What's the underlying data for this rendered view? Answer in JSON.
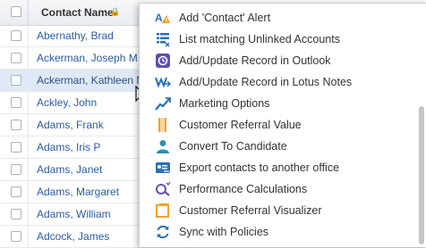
{
  "grid": {
    "header": {
      "column_title": "Contact Name"
    },
    "rows": [
      {
        "name": "Abernathy, Brad"
      },
      {
        "name": "Ackerman, Joseph M."
      },
      {
        "name": "Ackerman, Kathleen M"
      },
      {
        "name": "Ackley, John"
      },
      {
        "name": "Adams, Frank"
      },
      {
        "name": "Adams, Iris P"
      },
      {
        "name": "Adams, Janet"
      },
      {
        "name": "Adams, Margaret"
      },
      {
        "name": "Adams, William"
      },
      {
        "name": "Adcock, James"
      }
    ]
  },
  "context_menu": {
    "items": [
      {
        "label": "Add 'Contact' Alert",
        "icon": "alert-icon"
      },
      {
        "label": "List matching Unlinked Accounts",
        "icon": "list-icon"
      },
      {
        "label": "Add/Update Record in Outlook",
        "icon": "outlook-icon"
      },
      {
        "label": "Add/Update Record in Lotus Notes",
        "icon": "lotus-notes-icon"
      },
      {
        "label": "Marketing Options",
        "icon": "trend-chart-icon"
      },
      {
        "label": "Customer Referral Value",
        "icon": "referral-value-icon"
      },
      {
        "label": "Convert To Candidate",
        "icon": "person-icon"
      },
      {
        "label": "Export contacts to another office",
        "icon": "export-card-icon"
      },
      {
        "label": "Performance Calculations",
        "icon": "performance-icon"
      },
      {
        "label": "Customer Referral Visualizer",
        "icon": "visualizer-icon"
      },
      {
        "label": "Sync with Policies",
        "icon": "sync-icon"
      }
    ]
  },
  "colors": {
    "link_blue": "#2b5c9e",
    "selected_row": "#dfe9f6",
    "header_bg": "#eef0f3"
  }
}
